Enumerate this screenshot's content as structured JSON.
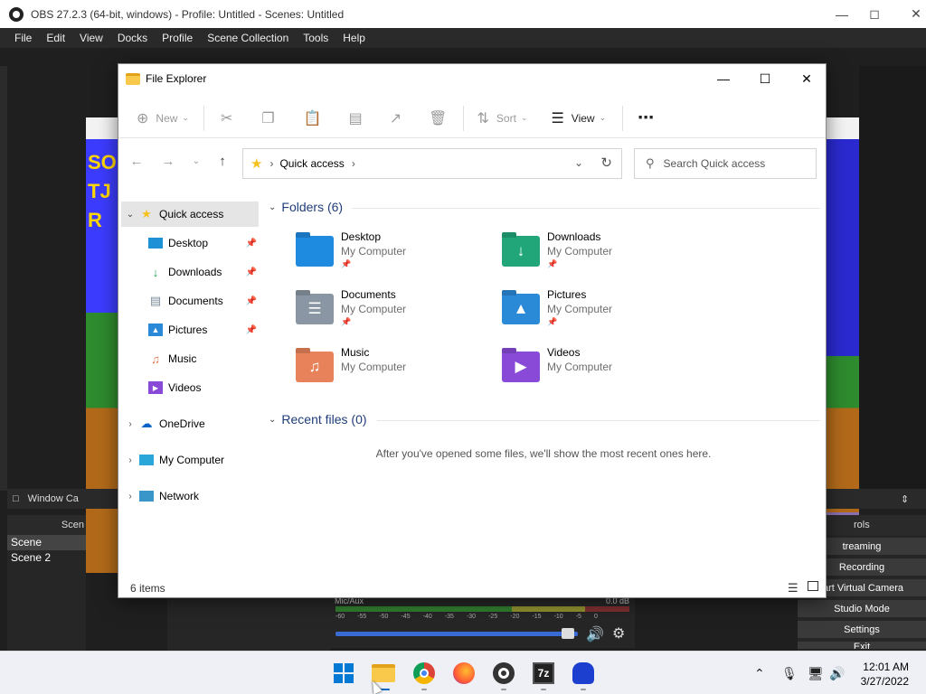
{
  "obs": {
    "title": "OBS 27.2.3 (64-bit, windows) - Profile: Untitled - Scenes: Untitled",
    "menu": [
      "File",
      "Edit",
      "View",
      "Docks",
      "Profile",
      "Scene Collection",
      "Tools",
      "Help"
    ],
    "source_label": "Window Ca",
    "scenes_header": "Scen",
    "scenes": [
      "Scene",
      "Scene 2"
    ],
    "mixer": {
      "label": "Mic/Aux",
      "db": "0.0 dB",
      "ticks": [
        "-60",
        "-55",
        "-50",
        "-45",
        "-40",
        "-35",
        "-30",
        "-25",
        "-20",
        "-15",
        "-10",
        "-5",
        "0"
      ]
    },
    "controls_header": "rols",
    "controls": [
      "treaming",
      "Recording",
      "tart Virtual Camera",
      "Studio Mode",
      "Settings",
      "Exit"
    ]
  },
  "explorer": {
    "title": "File Explorer",
    "toolbar": {
      "new": "New",
      "sort": "Sort",
      "view": "View"
    },
    "address": {
      "crumb": "Quick access"
    },
    "search": {
      "placeholder": "Search Quick access"
    },
    "nav": {
      "quick_access": "Quick access",
      "items": [
        "Desktop",
        "Downloads",
        "Documents",
        "Pictures",
        "Music",
        "Videos"
      ],
      "onedrive": "OneDrive",
      "my_computer": "My Computer",
      "network": "Network"
    },
    "folders_header": "Folders (6)",
    "folders": [
      {
        "name": "Desktop",
        "location": "My Computer",
        "pinned": true
      },
      {
        "name": "Downloads",
        "location": "My Computer",
        "pinned": true
      },
      {
        "name": "Documents",
        "location": "My Computer",
        "pinned": true
      },
      {
        "name": "Pictures",
        "location": "My Computer",
        "pinned": true
      },
      {
        "name": "Music",
        "location": "My Computer",
        "pinned": false
      },
      {
        "name": "Videos",
        "location": "My Computer",
        "pinned": false
      }
    ],
    "recent_header": "Recent files (0)",
    "recent_empty": "After you've opened some files, we'll show the most recent ones here.",
    "status": "6 items"
  },
  "taskbar": {
    "time": "12:01 AM",
    "date": "3/27/2022"
  },
  "colors": {
    "accent": "#0078d4",
    "section": "#1f3d7a",
    "selection": "#e5e5e5"
  }
}
